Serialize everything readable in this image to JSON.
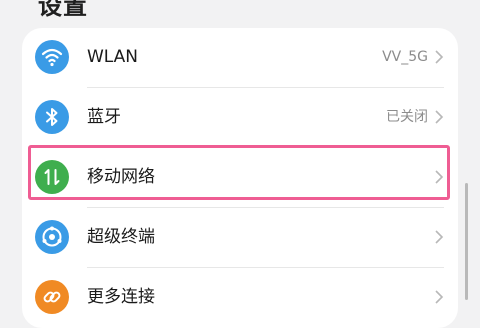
{
  "header": {
    "title": "设置"
  },
  "colors": {
    "blue_icon": "#3a9be6",
    "green_icon": "#3fae4e",
    "orange_icon": "#f08a24",
    "highlight": "#ef5d93"
  },
  "settings": {
    "items": [
      {
        "label": "WLAN",
        "value": "VV_5G",
        "icon": "wifi-icon"
      },
      {
        "label": "蓝牙",
        "value": "已关闭",
        "icon": "bluetooth-icon"
      },
      {
        "label": "移动网络",
        "value": "",
        "icon": "mobile-network-icon"
      },
      {
        "label": "超级终端",
        "value": "",
        "icon": "super-device-icon"
      },
      {
        "label": "更多连接",
        "value": "",
        "icon": "link-icon"
      }
    ]
  }
}
